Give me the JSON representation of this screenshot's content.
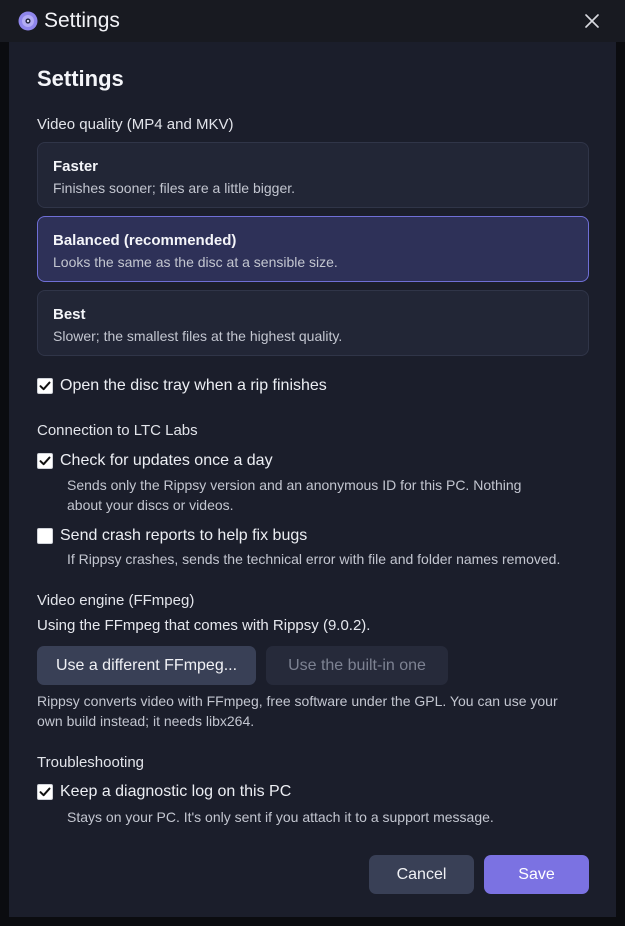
{
  "window": {
    "title": "Settings",
    "icon": "disc-app-icon",
    "close_icon": "close-icon"
  },
  "page": {
    "heading": "Settings"
  },
  "video_quality": {
    "label": "Video quality (MP4 and MKV)",
    "selected": "balanced",
    "options": [
      {
        "id": "faster",
        "title": "Faster",
        "description": "Finishes sooner; files are a little bigger."
      },
      {
        "id": "balanced",
        "title": "Balanced (recommended)",
        "description": "Looks the same as the disc at a sensible size."
      },
      {
        "id": "best",
        "title": "Best",
        "description": "Slower; the smallest files at the highest quality."
      }
    ]
  },
  "open_tray": {
    "label": "Open the disc tray when a rip finishes",
    "checked": true
  },
  "connection": {
    "label": "Connection to LTC Labs",
    "check_updates": {
      "label": "Check for updates once a day",
      "checked": true,
      "help_line1": "Sends only the Rippsy version and an anonymous ID for this PC. Nothing",
      "help_line2": "about your discs or videos."
    },
    "crash_reports": {
      "label": "Send crash reports to help fix bugs",
      "checked": false,
      "help": "If Rippsy crashes, sends the technical error with file and folder names removed."
    }
  },
  "engine": {
    "label": "Video engine (FFmpeg)",
    "status": "Using the FFmpeg that comes with Rippsy (9.0.2).",
    "use_different_label": "Use a different FFmpeg...",
    "use_builtin_label": "Use the built-in one",
    "info_line1": "Rippsy converts video with FFmpeg, free software under the GPL. You can use your",
    "info_line2": "own build instead; it needs libx264."
  },
  "troubleshooting": {
    "label": "Troubleshooting",
    "diagnostic_log": {
      "label": "Keep a diagnostic log on this PC",
      "checked": true,
      "help": "Stays on your PC. It's only sent if you attach it to a support message."
    }
  },
  "footer": {
    "cancel_label": "Cancel",
    "save_label": "Save"
  },
  "colors": {
    "accent": "#7b72e2",
    "panel": "#1b1e2b",
    "selected_border": "#6f6fd6"
  }
}
